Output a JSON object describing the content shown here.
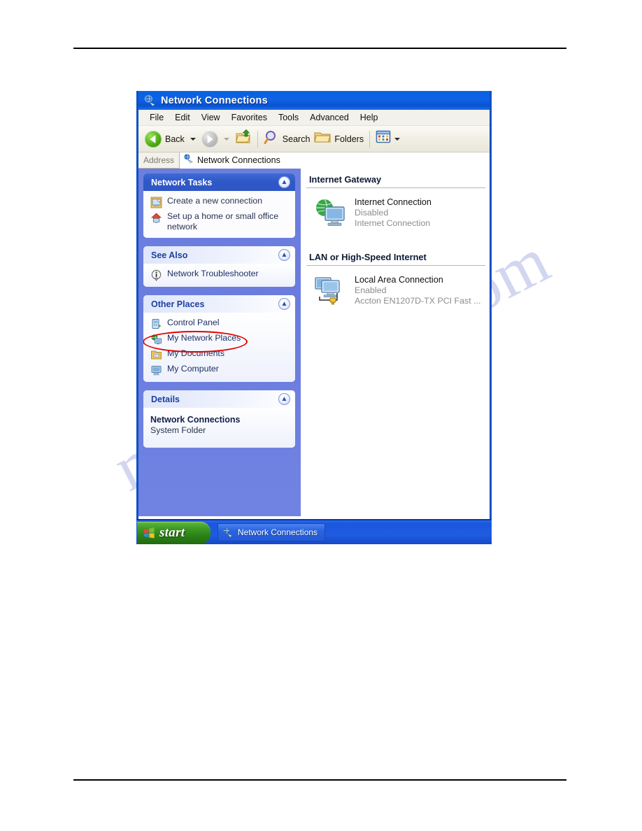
{
  "document": {
    "watermark_text": "manualshive.com"
  },
  "window": {
    "title": "Network Connections",
    "title_icon": "network-connections-icon",
    "menu": [
      {
        "label": "File"
      },
      {
        "label": "Edit"
      },
      {
        "label": "View"
      },
      {
        "label": "Favorites"
      },
      {
        "label": "Tools"
      },
      {
        "label": "Advanced"
      },
      {
        "label": "Help"
      }
    ],
    "toolbar": {
      "back_label": "Back",
      "back_icon": "back-arrow-icon",
      "forward_icon": "forward-arrow-icon",
      "up_icon": "up-one-level-folder-icon",
      "search_label": "Search",
      "search_icon": "magnifier-icon",
      "folders_label": "Folders",
      "folders_icon": "folder-icon",
      "views_icon": "views-icon"
    },
    "address": {
      "label": "Address",
      "value": "Network Connections",
      "icon": "network-connections-icon"
    }
  },
  "sidebar": {
    "panels": [
      {
        "title": "Network Tasks",
        "style": "dark",
        "collapse_icon": "chevron-up-icon",
        "links": [
          {
            "label": "Create a new connection",
            "icon": "new-connection-icon"
          },
          {
            "label": "Set up a home or small office network",
            "icon": "home-network-icon"
          }
        ]
      },
      {
        "title": "See Also",
        "style": "light",
        "collapse_icon": "chevron-up-icon",
        "links": [
          {
            "label": "Network Troubleshooter",
            "icon": "info-icon"
          }
        ]
      },
      {
        "title": "Other Places",
        "style": "light",
        "collapse_icon": "chevron-up-icon",
        "links": [
          {
            "label": "Control Panel",
            "icon": "control-panel-icon"
          },
          {
            "label": "My Network Places",
            "icon": "my-network-places-icon",
            "highlighted": true
          },
          {
            "label": "My Documents",
            "icon": "my-documents-icon"
          },
          {
            "label": "My Computer",
            "icon": "my-computer-icon"
          }
        ]
      },
      {
        "title": "Details",
        "style": "light",
        "collapse_icon": "chevron-up-icon",
        "detail_title": "Network Connections",
        "detail_sub": "System Folder"
      }
    ]
  },
  "content": {
    "sections": [
      {
        "heading": "Internet Gateway",
        "items": [
          {
            "name": "Internet Connection",
            "status": "Disabled",
            "device": "Internet Connection",
            "icon": "internet-gateway-icon"
          }
        ]
      },
      {
        "heading": "LAN or High-Speed Internet",
        "items": [
          {
            "name": "Local Area Connection",
            "status": "Enabled",
            "device": "Accton EN1207D-TX PCI Fast ...",
            "icon": "lan-connection-icon"
          }
        ]
      }
    ]
  },
  "taskbar": {
    "start_label": "start",
    "start_icon": "windows-flag-icon",
    "items": [
      {
        "label": "Network Connections",
        "icon": "network-connections-icon"
      }
    ]
  },
  "colors": {
    "titlebar_blue": "#0f63e6",
    "sidebar_blue": "#6c7ede",
    "panel_head_dark": "#2f57c6",
    "annotation_red": "#e00000",
    "taskbar_blue": "#1f5ce2",
    "start_green": "#3e9a24",
    "watermark": "#b9bde8"
  }
}
